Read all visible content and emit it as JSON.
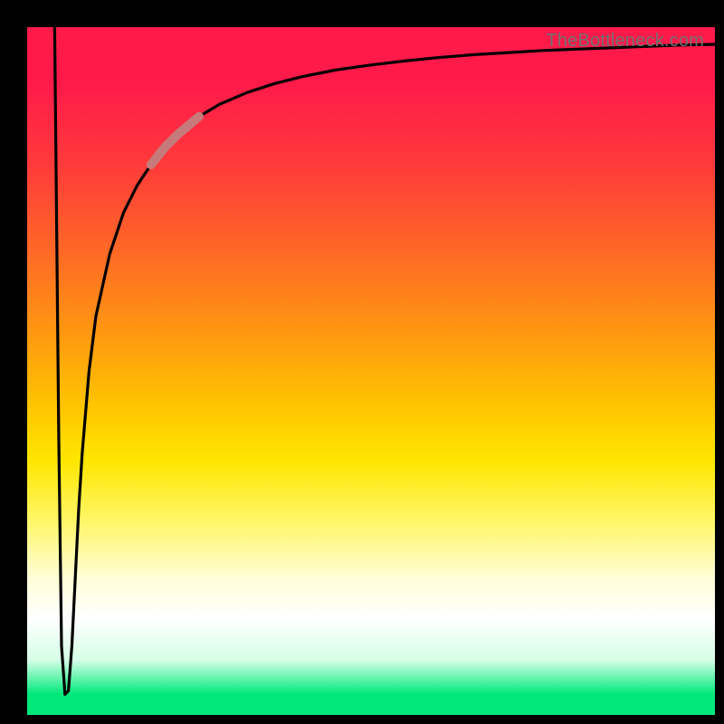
{
  "watermark": "TheBottleneck.com",
  "chart_data": {
    "type": "line",
    "title": "",
    "xlabel": "",
    "ylabel": "",
    "xlim": [
      0,
      100
    ],
    "ylim": [
      0,
      100
    ],
    "series": [
      {
        "name": "bottleneck-curve",
        "x": [
          4.0,
          4.3,
          4.6,
          5.0,
          5.5,
          6.0,
          6.5,
          7.0,
          7.5,
          8.0,
          9.0,
          10.0,
          12.0,
          14.0,
          16.0,
          18.0,
          20.0,
          22.0,
          25.0,
          28.0,
          32.0,
          36.0,
          40.0,
          45.0,
          50.0,
          55.0,
          60.0,
          65.0,
          70.0,
          75.0,
          80.0,
          85.0,
          90.0,
          95.0,
          100.0
        ],
        "y": [
          100.0,
          70.0,
          40.0,
          10.0,
          3.0,
          3.5,
          10.0,
          20.0,
          30.0,
          38.0,
          50.0,
          58.0,
          67.0,
          73.0,
          77.0,
          80.0,
          82.5,
          84.5,
          87.0,
          88.8,
          90.5,
          91.8,
          92.8,
          93.8,
          94.5,
          95.1,
          95.6,
          96.0,
          96.3,
          96.6,
          96.8,
          97.0,
          97.2,
          97.4,
          97.5
        ]
      },
      {
        "name": "highlight-segment",
        "x": [
          18.0,
          20.0,
          22.0,
          25.0
        ],
        "y": [
          80.0,
          82.5,
          84.5,
          87.0
        ]
      }
    ],
    "colors": {
      "curve": "#000000",
      "highlight": "#c77a7a"
    }
  }
}
